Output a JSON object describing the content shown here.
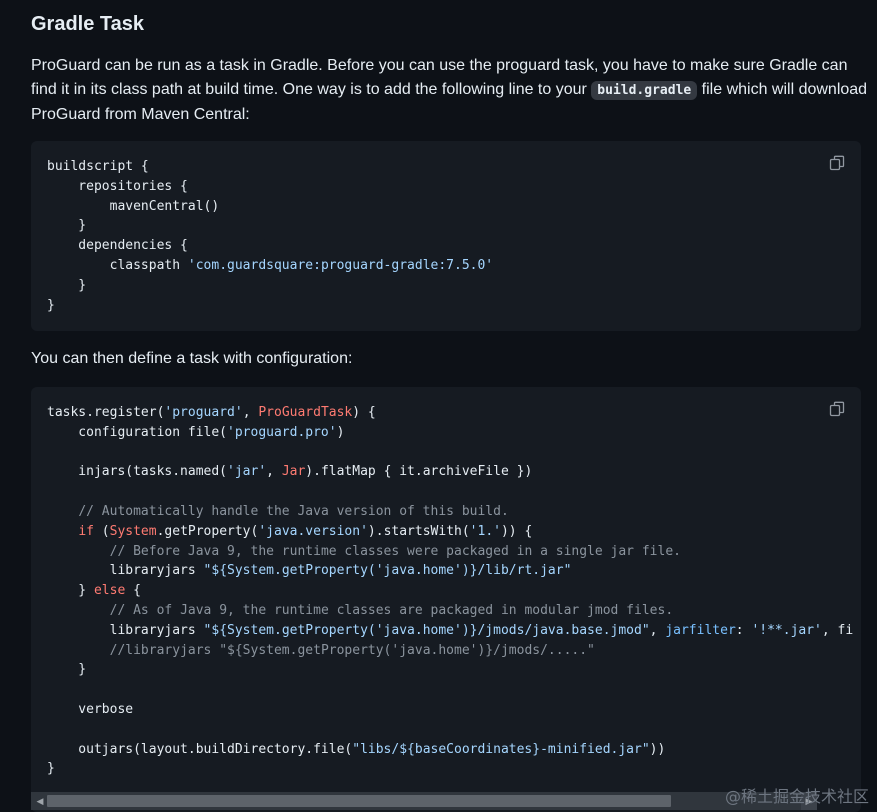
{
  "section": {
    "heading": "Gradle Task",
    "paragraph1_before": "ProGuard can be run as a task in Gradle. Before you can use the proguard task, you have to make sure Gradle can find it in its class path at build time. One way is to add the following line to your ",
    "paragraph1_code": "build.gradle",
    "paragraph1_after": " file which will download ProGuard from Maven Central:",
    "paragraph2": "You can then define a task with configuration:"
  },
  "code_block_1": {
    "lines": [
      "buildscript {",
      "    repositories {",
      "        mavenCentral()",
      "    }",
      "    dependencies {",
      "        classpath 'com.guardsquare:proguard-gradle:7.5.0'",
      "    }",
      "}"
    ]
  },
  "code_block_2": {
    "lines": [
      "tasks.register('proguard', ProGuardTask) {",
      "    configuration file('proguard.pro')",
      "",
      "    injars(tasks.named('jar', Jar).flatMap { it.archiveFile })",
      "",
      "    // Automatically handle the Java version of this build.",
      "    if (System.getProperty('java.version').startsWith('1.')) {",
      "        // Before Java 9, the runtime classes were packaged in a single jar file.",
      "        libraryjars \"${System.getProperty('java.home')}/lib/rt.jar\"",
      "    } else {",
      "        // As of Java 9, the runtime classes are packaged in modular jmod files.",
      "        libraryjars \"${System.getProperty('java.home')}/jmods/java.base.jmod\", jarfilter: '!**.jar', fi",
      "        //libraryjars \"${System.getProperty('java.home')}/jmods/.....\"",
      "    }",
      "",
      "    verbose",
      "",
      "    outjars(layout.buildDirectory.file(\"libs/${baseCoordinates}-minified.jar\"))",
      "}"
    ]
  },
  "scrollbar": {
    "scroll_fraction": 0.78
  },
  "watermark": "@稀土掘金技术社区",
  "icons": {
    "copy": "copy-icon",
    "scroll_left": "scroll-left-arrow-icon",
    "scroll_right": "scroll-right-arrow-icon"
  }
}
